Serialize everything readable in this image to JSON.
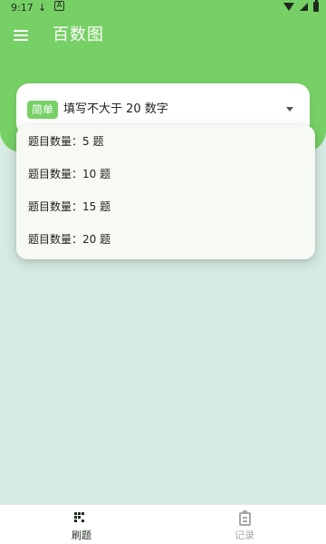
{
  "status_bar": {
    "time": "9:17",
    "download_glyph": "↓",
    "app_glyph": "A"
  },
  "header": {
    "title": "百数图"
  },
  "selector": {
    "difficulty": "简单",
    "quiz_type": "填写不大于 20 数字"
  },
  "dropdown": {
    "options": [
      "题目数量：5 题",
      "题目数量：10 题",
      "题目数量：15 题",
      "题目数量：20 题"
    ]
  },
  "bottom_nav": {
    "items": [
      {
        "label": "刷题",
        "icon": "practice-grid-icon",
        "active": true
      },
      {
        "label": "记录",
        "icon": "clipboard-icon",
        "active": false
      }
    ]
  },
  "colors": {
    "primary": "#77d066",
    "background": "#d7ebe4",
    "surface": "#ffffff",
    "menu_surface": "#f6faf2",
    "inactive": "#a6aaa6"
  }
}
